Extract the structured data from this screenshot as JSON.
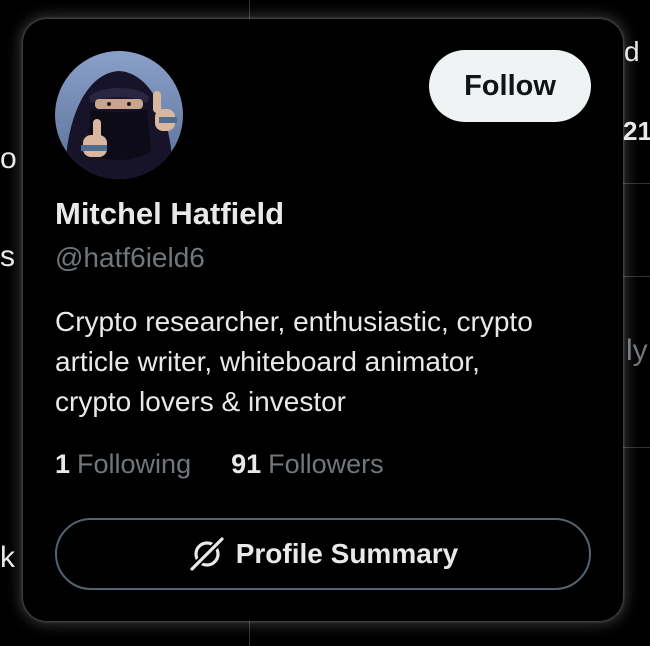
{
  "background": {
    "fragments": [
      "d",
      "21",
      "o",
      "s",
      "ly",
      "k"
    ]
  },
  "hover_card": {
    "avatar_icon": "user-avatar",
    "follow_label": "Follow",
    "display_name": "Mitchel Hatfield",
    "handle": "@hatf6ield6",
    "bio_lines": [
      "Crypto researcher, enthusiastic, crypto",
      "article writer, whiteboard animator,",
      "crypto lovers & investor"
    ],
    "following": {
      "count": "1",
      "label": "Following"
    },
    "followers": {
      "count": "91",
      "label": "Followers"
    },
    "summary_button": {
      "icon": "grok-icon",
      "label": "Profile Summary"
    }
  },
  "colors": {
    "background": "#000000",
    "text_primary": "#e7e9ea",
    "text_secondary": "#71767b",
    "follow_bg": "#eff3f4",
    "border": "#536471"
  }
}
